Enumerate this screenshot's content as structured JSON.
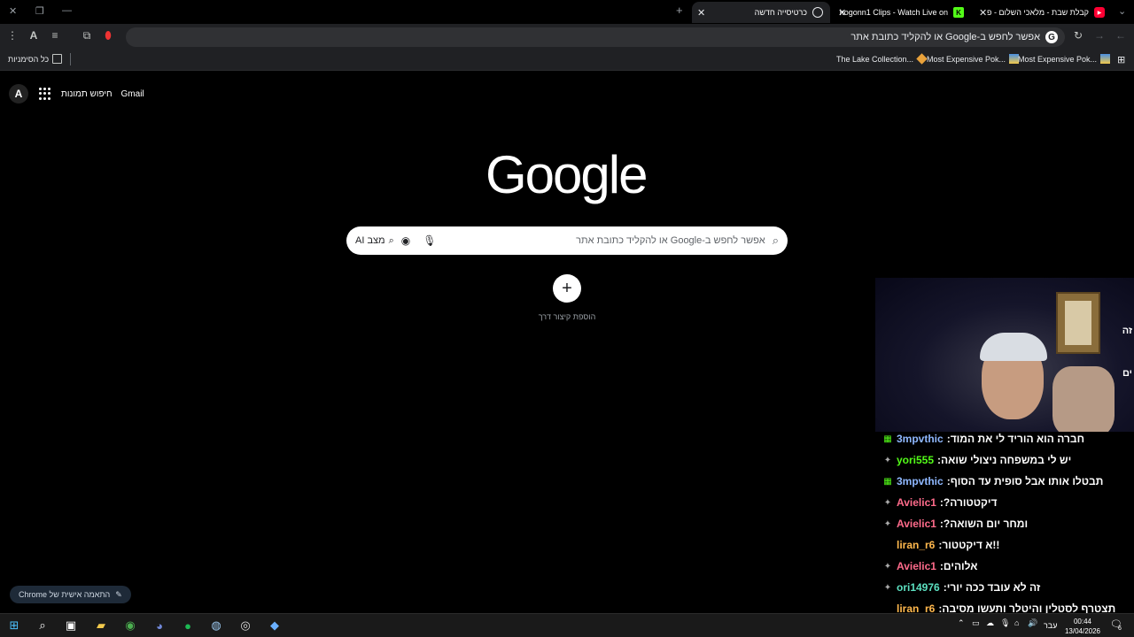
{
  "tabs": [
    {
      "label": "קבלת שבת - מלאכי השלום - פ",
      "icon": "youtube-icon",
      "color": "#ff0033"
    },
    {
      "label": "Shogonn1 Clips - Watch Live on",
      "icon": "kick-icon",
      "color": "#53fc18"
    },
    {
      "label": "כרטיסייה חדשה",
      "icon": "chrome-icon",
      "color": "#e8eaed"
    }
  ],
  "new_tab_symbol": "+",
  "omnibox": {
    "placeholder": "אפשר לחפש ב-Google או להקליד כתובת אתר",
    "g": "G"
  },
  "bookmarks": {
    "items": [
      {
        "label": "Most Expensive Pok...",
        "icon": "pokemon-icon"
      },
      {
        "label": "Most Expensive Pok...",
        "icon": "pokemon-icon"
      },
      {
        "label": "The Lake Collection...",
        "icon": "diamond-icon"
      }
    ],
    "all_bookmarks": "כל הסימניות"
  },
  "topnav": {
    "gmail": "Gmail",
    "images": "חיפוש תמונות",
    "avatar": "A"
  },
  "logo": "Google",
  "search": {
    "placeholder": "אפשר לחפש ב-Google או להקליד כתובת אתר",
    "ai_mode": "מצב AI"
  },
  "shortcut": {
    "symbol": "+",
    "label": "הוספת קיצור דרך"
  },
  "customize": {
    "label": "התאמה אישית של Chrome"
  },
  "webcam_side": [
    "זה",
    "ים"
  ],
  "chat": [
    {
      "user": "3mpvthic",
      "msg": "חברה הוא הוריד לי את המוד",
      "color": "#8fb8ff",
      "badge": "partner"
    },
    {
      "user": "yori555",
      "msg": "יש לי במשפחה ניצולי שואה",
      "color": "#53fc18",
      "badge": "sub"
    },
    {
      "user": "3mpvthic",
      "msg": "תבטלו אותו אבל סופית עד הסוף",
      "color": "#8fb8ff",
      "badge": "partner"
    },
    {
      "user": "Avielic1",
      "msg": "דיקטטורה?",
      "color": "#ff6b8b",
      "badge": "sub"
    },
    {
      "user": "Avielic1",
      "msg": "ומחר יום השואה?",
      "color": "#ff6b8b",
      "badge": "sub"
    },
    {
      "user": "liran_r6",
      "msg": "!!א דיקטטור",
      "color": "#ffb84d",
      "badge": ""
    },
    {
      "user": "Avielic1",
      "msg": "אלוהים",
      "color": "#ff6b8b",
      "badge": "sub"
    },
    {
      "user": "ori14976",
      "msg": "זה לא עובד ככה יורי",
      "color": "#5ce0c0",
      "badge": "sub"
    },
    {
      "user": "liran_r6",
      "msg": "תצטרף לסטלין והיטלר ותעשו מסיבה",
      "color": "#ffb84d",
      "badge": ""
    }
  ],
  "taskbar": {
    "apps": [
      "start-icon",
      "search-icon",
      "task-view-icon",
      "file-explorer-icon",
      "chrome-icon",
      "discord-icon",
      "spotify-icon",
      "steam-icon",
      "obs-icon",
      "app-icon"
    ],
    "lang": "עבר",
    "time": "00:44",
    "date": "13/04/2026",
    "notifications": "6"
  }
}
